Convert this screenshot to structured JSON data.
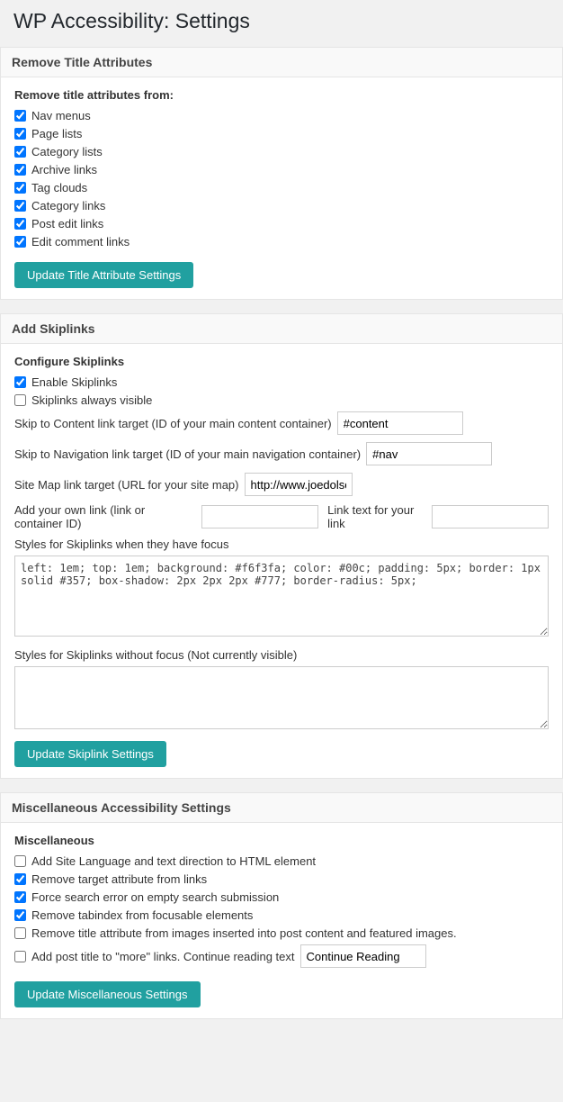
{
  "page": {
    "title": "WP Accessibility: Settings"
  },
  "remove_title": {
    "section_header": "Remove Title Attributes",
    "sub_header": "Remove title attributes from:",
    "checkboxes": [
      {
        "id": "nav_menus",
        "label": "Nav menus",
        "checked": true
      },
      {
        "id": "page_lists",
        "label": "Page lists",
        "checked": true
      },
      {
        "id": "category_lists",
        "label": "Category lists",
        "checked": true
      },
      {
        "id": "archive_links",
        "label": "Archive links",
        "checked": true
      },
      {
        "id": "tag_clouds",
        "label": "Tag clouds",
        "checked": true
      },
      {
        "id": "category_links",
        "label": "Category links",
        "checked": true
      },
      {
        "id": "post_edit_links",
        "label": "Post edit links",
        "checked": true
      },
      {
        "id": "edit_comment_links",
        "label": "Edit comment links",
        "checked": true
      }
    ],
    "button_label": "Update Title Attribute Settings"
  },
  "skiplinks": {
    "section_header": "Add Skiplinks",
    "sub_header": "Configure Skiplinks",
    "checkboxes": [
      {
        "id": "enable_skiplinks",
        "label": "Enable Skiplinks",
        "checked": true
      },
      {
        "id": "skiplinks_always_visible",
        "label": "Skiplinks always visible",
        "checked": false
      }
    ],
    "fields": [
      {
        "id": "skip_content",
        "label": "Skip to Content link target (ID of your main content container)",
        "value": "#content"
      },
      {
        "id": "skip_nav",
        "label": "Skip to Navigation link target (ID of your main navigation container)",
        "value": "#nav"
      },
      {
        "id": "site_map",
        "label": "Site Map link target (URL for your site map)",
        "value": "http://www.joedolson.c"
      }
    ],
    "own_link_label": "Add your own link (link or container ID)",
    "own_link_value": "",
    "link_text_label": "Link text for your link",
    "link_text_value": "",
    "focus_style_label": "Styles for Skiplinks when they have focus",
    "focus_style_value": "left: 1em; top: 1em; background: #f6f3fa; color: #00c; padding: 5px; border: 1px solid #357; box-shadow: 2px 2px 2px #777; border-radius: 5px;",
    "no_focus_style_label": "Styles for Skiplinks without focus (Not currently visible)",
    "no_focus_style_value": "",
    "button_label": "Update Skiplink Settings"
  },
  "miscellaneous": {
    "section_header": "Miscellaneous Accessibility Settings",
    "sub_header": "Miscellaneous",
    "checkboxes": [
      {
        "id": "add_site_language",
        "label": "Add Site Language and text direction to HTML element",
        "checked": false
      },
      {
        "id": "remove_target",
        "label": "Remove target attribute from links",
        "checked": true
      },
      {
        "id": "force_search_error",
        "label": "Force search error on empty search submission",
        "checked": true
      },
      {
        "id": "remove_tabindex",
        "label": "Remove tabindex from focusable elements",
        "checked": true
      },
      {
        "id": "remove_title_images",
        "label": "Remove title attribute from images inserted into post content and featured images.",
        "checked": false
      },
      {
        "id": "add_post_title",
        "label": "Add post title to \"more\" links. Continue reading text",
        "checked": false
      }
    ],
    "continue_reading_value": "Continue Reading",
    "button_label": "Update Miscellaneous Settings"
  }
}
